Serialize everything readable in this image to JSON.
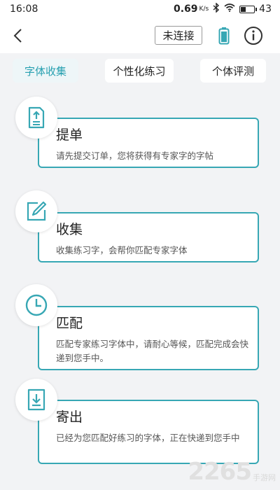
{
  "status_bar": {
    "time": "16:08",
    "net_speed": "0.69",
    "net_unit": "K/s",
    "battery_level": "43",
    "battery_fraction": 0.43
  },
  "header": {
    "connection_label": "未连接"
  },
  "tabs": [
    {
      "label": "字体收集",
      "active": true
    },
    {
      "label": "个性化练习",
      "active": false
    },
    {
      "label": "个体评测",
      "active": false
    }
  ],
  "steps": [
    {
      "title": "提单",
      "desc": "请先提交订单，您将获得有专家字的字帖",
      "icon": "upload-document-icon"
    },
    {
      "title": "收集",
      "desc": "收集练习字，会帮你匹配专家字体",
      "icon": "edit-pencil-icon"
    },
    {
      "title": "匹配",
      "desc": "匹配专家练习字体中，请耐心等候，匹配完成会快递到您手中。",
      "icon": "clock-icon"
    },
    {
      "title": "寄出",
      "desc": "已经为您匹配好练习的字体，正在快递到您手中",
      "icon": "download-icon"
    }
  ],
  "watermark": {
    "number": "2265",
    "text": "手游网"
  },
  "colors": {
    "accent": "#37a7b4",
    "active_tab_text": "#27a0b0",
    "background": "#f2f3f5"
  }
}
